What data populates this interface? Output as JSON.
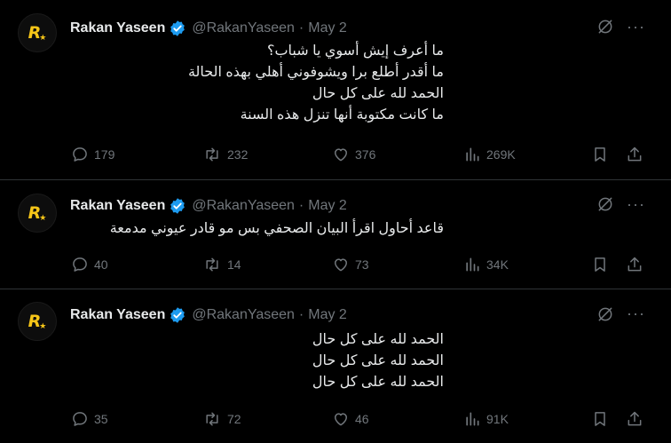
{
  "tweets": [
    {
      "author_name": "Rakan Yaseen",
      "handle": "@RakanYaseen",
      "separator": "·",
      "date": "May 2",
      "lines": [
        "ما أعرف إيش أسوي يا شباب؟",
        "ما أقدر أطلع برا ويشوفوني أهلي بهذه الحالة",
        "الحمد لله على كل حال",
        "ما كانت مكتوبة أنها تنزل هذه السنة"
      ],
      "replies": "179",
      "retweets": "232",
      "likes": "376",
      "views": "269K"
    },
    {
      "author_name": "Rakan Yaseen",
      "handle": "@RakanYaseen",
      "separator": "·",
      "date": "May 2",
      "lines": [
        "قاعد أحاول اقرأ البيان الصحفي بس مو قادر عيوني مدمعة"
      ],
      "replies": "40",
      "retweets": "14",
      "likes": "73",
      "views": "34K"
    },
    {
      "author_name": "Rakan Yaseen",
      "handle": "@RakanYaseen",
      "separator": "·",
      "date": "May 2",
      "lines": [
        "الحمد لله على كل حال",
        "الحمد لله على كل حال",
        "الحمد لله على كل حال"
      ],
      "replies": "35",
      "retweets": "72",
      "likes": "46",
      "views": "91K"
    }
  ],
  "avatar_logo": "R★",
  "more_label": "···",
  "colors": {
    "background": "#000000",
    "text": "#e7e9ea",
    "muted": "#71767b",
    "verified": "#1d9bf0",
    "divider": "#2f3336",
    "logo": "#f5c518"
  },
  "icons": [
    "verified-badge-icon",
    "grok-icon",
    "more-icon",
    "reply-icon",
    "retweet-icon",
    "like-icon",
    "views-icon",
    "bookmark-icon",
    "share-icon"
  ]
}
